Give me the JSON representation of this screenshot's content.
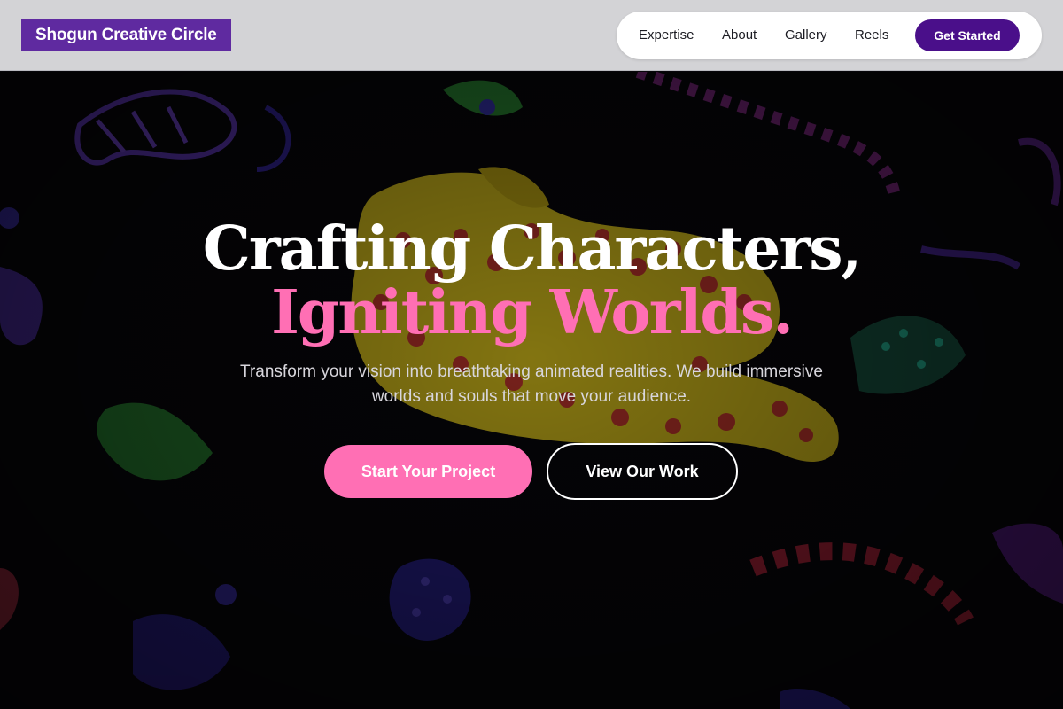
{
  "header": {
    "logo_text": "Shogun Creative Circle",
    "nav": [
      {
        "label": "Expertise"
      },
      {
        "label": "About"
      },
      {
        "label": "Gallery"
      },
      {
        "label": "Reels"
      }
    ],
    "cta_label": "Get Started"
  },
  "hero": {
    "headline_line1": "Crafting Characters,",
    "headline_line2": "Igniting Worlds.",
    "subtext": "Transform your vision into breathtaking animated realities. We build immersive worlds and souls that move your audience.",
    "primary_button": "Start Your Project",
    "secondary_button": "View Our Work"
  },
  "colors": {
    "logo_bg": "#5f2aa0",
    "nav_cta_bg": "#4a0f8a",
    "accent_pink": "#ff6fb4",
    "header_bg": "#d3d3d6"
  }
}
